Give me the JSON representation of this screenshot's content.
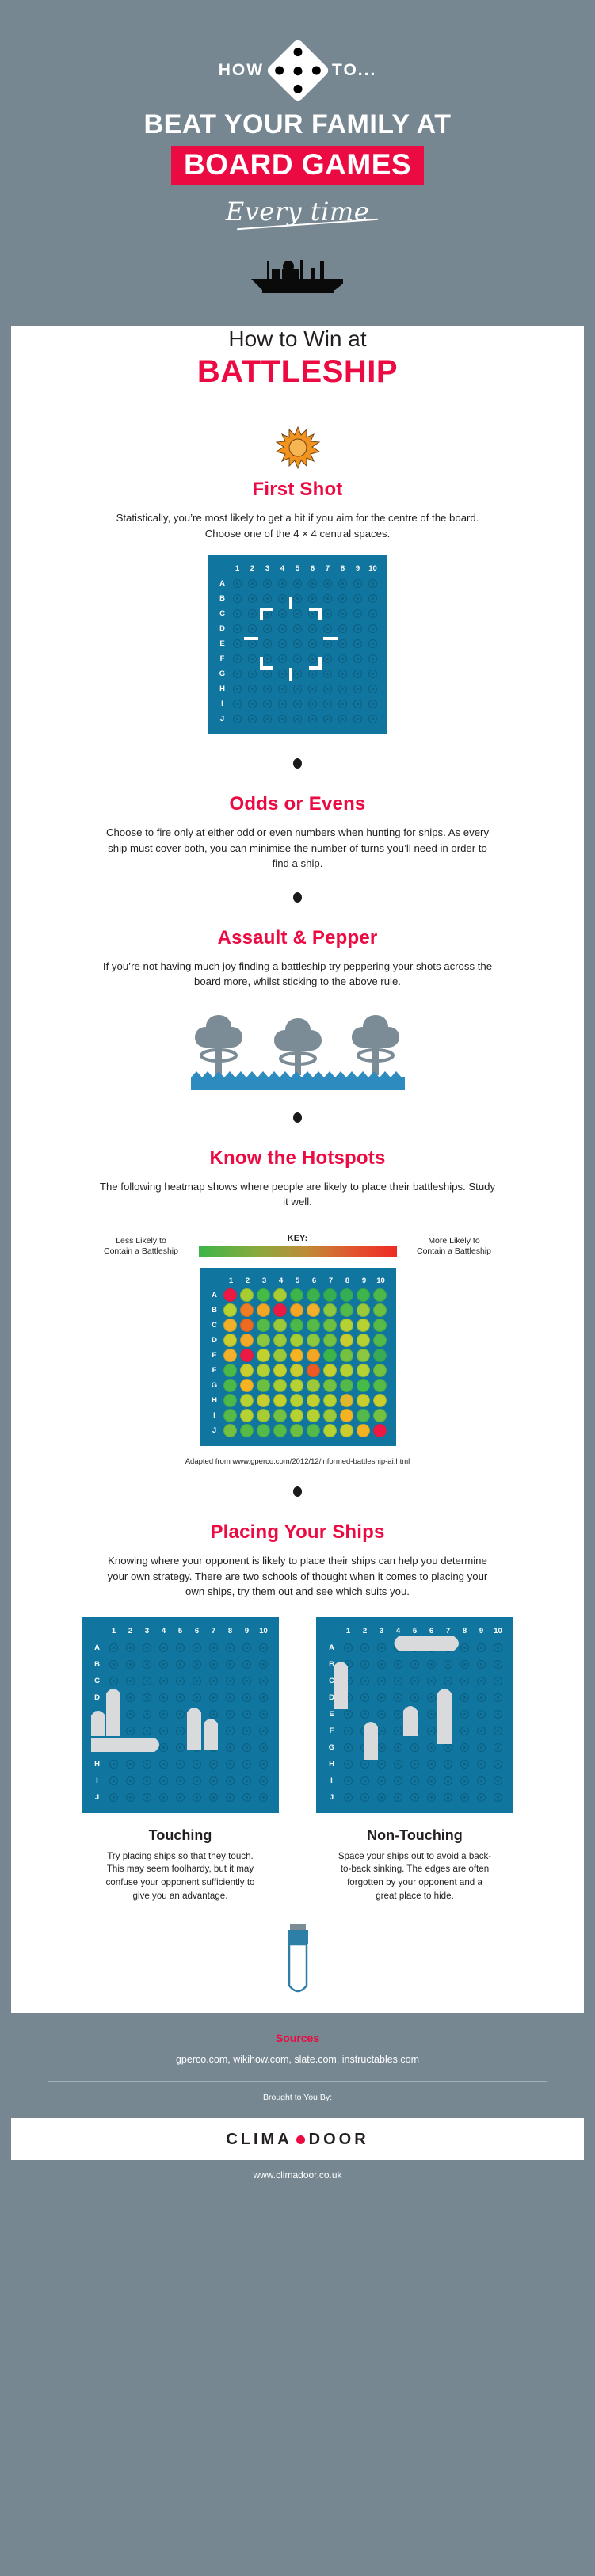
{
  "hero": {
    "kicker_left": "HOW",
    "kicker_right": "TO...",
    "die_icon": "dice-five-diamond-icon",
    "line1": "BEAT YOUR FAMILY AT",
    "line2": "BOARD GAMES",
    "script": "Every time",
    "band_color": "#ec0a43",
    "bg_color": "#768791"
  },
  "page": {
    "title_small": "How to Win at",
    "title_big": "BATTLESHIP",
    "ship_icon": "battleship-silhouette-icon"
  },
  "sections": [
    {
      "id": "first-shot",
      "icon": "sun-burst-icon",
      "title": "First Shot",
      "body": "Statistically, you’re most likely to get a hit if you aim for the centre of the board. Choose one of the 4 × 4 central spaces."
    },
    {
      "id": "odds-or-evens",
      "title": "Odds or Evens",
      "body": "Choose to fire only at either odd or even numbers when hunting for ships. As every ship must cover both, you can minimise the number of turns you’ll need in order to find a ship."
    },
    {
      "id": "assault-and-pepper",
      "title": "Assault & Pepper",
      "body": "If you’re not having much joy finding a battleship try peppering your shots across the board more, whilst sticking to the above rule.",
      "icon": "water-splash-icon"
    },
    {
      "id": "know-the-hotspots",
      "title": "Know the Hotspots",
      "body": "The following heatmap shows where people are likely to place their battleships. Study it well."
    },
    {
      "id": "placing-your-ships",
      "title": "Placing Your Ships",
      "body": "Knowing where your opponent is likely to place their ships can help you determine your own strategy. There are two schools of thought when it comes to placing your own ships, try them out and see which suits you."
    }
  ],
  "grid": {
    "columns": [
      "1",
      "2",
      "3",
      "4",
      "5",
      "6",
      "7",
      "8",
      "9",
      "10"
    ],
    "rows": [
      "A",
      "B",
      "C",
      "D",
      "E",
      "F",
      "G",
      "H",
      "I",
      "J"
    ],
    "board_color": "#10769f",
    "peg_color": "#0c5f80",
    "reticle_target": "D4 to G7 central 4 x 4"
  },
  "key": {
    "title": "KEY:",
    "left_label": "Less Likely to\nContain a Battleship",
    "right_label": "More Likely to\nContain a Battleship",
    "gradient_start": "#3db54a",
    "gradient_end": "#ee2b24"
  },
  "attribution": "Adapted from www.gperco.com/2012/12/informed-battleship-ai.html",
  "placement": {
    "left": {
      "label": "Touching",
      "body": "Try placing ships so that they touch. This may seem foolhardy, but it may confuse your opponent sufficiently to give you an advantage."
    },
    "right": {
      "label": "Non-Touching",
      "body": "Space your ships out to avoid a back-to-back sinking. The edges are often forgotten by your opponent and a great place to hide."
    }
  },
  "footer": {
    "sources_title": "Sources",
    "sources": "gperco.com, wikihow.com, slate.com, instructables.com",
    "brought_by": "Brought to You By:",
    "logo_part1": "CLIMA",
    "logo_part2": "DOOR",
    "site": "www.climadoor.co.uk"
  },
  "chart_data": {
    "type": "heatmap",
    "title": "Battleship placement heatmap",
    "xlabel": "",
    "ylabel": "",
    "categories": [
      "1",
      "2",
      "3",
      "4",
      "5",
      "6",
      "7",
      "8",
      "9",
      "10"
    ],
    "rows": [
      "A",
      "B",
      "C",
      "D",
      "E",
      "F",
      "G",
      "H",
      "I",
      "J"
    ],
    "legend": "Less Likely to Contain a Battleship → More Likely to Contain a Battleship",
    "colorscale": [
      "#3db54a",
      "#8dc63f",
      "#c9d12e",
      "#f5b324",
      "#f07f21",
      "#ee2b24"
    ],
    "values": [
      [
        "#ed1944",
        "#a8cd33",
        "#47bb48",
        "#a8cd33",
        "#3db54a",
        "#3bb24c",
        "#35ae52",
        "#34ae55",
        "#3fb44d",
        "#4cb84a"
      ],
      [
        "#b6d132",
        "#ef7b22",
        "#f5a623",
        "#ed1944",
        "#f7a524",
        "#f3b02a",
        "#8dc63f",
        "#52b94a",
        "#9cc93a",
        "#6dbf42"
      ],
      [
        "#f2b02a",
        "#ee6a21",
        "#56ba47",
        "#9cc93a",
        "#4cb84a",
        "#56ba47",
        "#6dbf42",
        "#b6d132",
        "#b6d132",
        "#56ba47"
      ],
      [
        "#c9cd2e",
        "#f2a92a",
        "#8dc63f",
        "#9cc93a",
        "#a8cd33",
        "#8dc63f",
        "#74c141",
        "#c9cd2e",
        "#b6d132",
        "#52b94a"
      ],
      [
        "#f3b02a",
        "#ed1944",
        "#c4d02e",
        "#9cc93a",
        "#f5b324",
        "#f3a623",
        "#3db54a",
        "#74c141",
        "#8dc63f",
        "#39ab58"
      ],
      [
        "#4cb84a",
        "#c9cd2e",
        "#b6d132",
        "#c4d02e",
        "#c9cd2e",
        "#ee5a21",
        "#c4d02e",
        "#b6d132",
        "#b6d132",
        "#74c141"
      ],
      [
        "#4cb84a",
        "#f5b324",
        "#6dbf42",
        "#a8cd33",
        "#b6d132",
        "#9cc93a",
        "#74c141",
        "#52b94a",
        "#47bb48",
        "#56ba47"
      ],
      [
        "#4cb84a",
        "#b6d132",
        "#c9cd2e",
        "#c4d02e",
        "#b6d132",
        "#c4d02e",
        "#b6d132",
        "#e0b62c",
        "#c9cd2e",
        "#c9cd2e"
      ],
      [
        "#56ba47",
        "#b6d132",
        "#a8cd33",
        "#74c141",
        "#b6d132",
        "#b6d132",
        "#9cc93a",
        "#f5b324",
        "#52b94a",
        "#74c141"
      ],
      [
        "#74c141",
        "#56ba47",
        "#52b94a",
        "#56ba47",
        "#6dbf42",
        "#52b94a",
        "#b6d132",
        "#c9cd2e",
        "#f5b324",
        "#ed1944"
      ]
    ]
  }
}
